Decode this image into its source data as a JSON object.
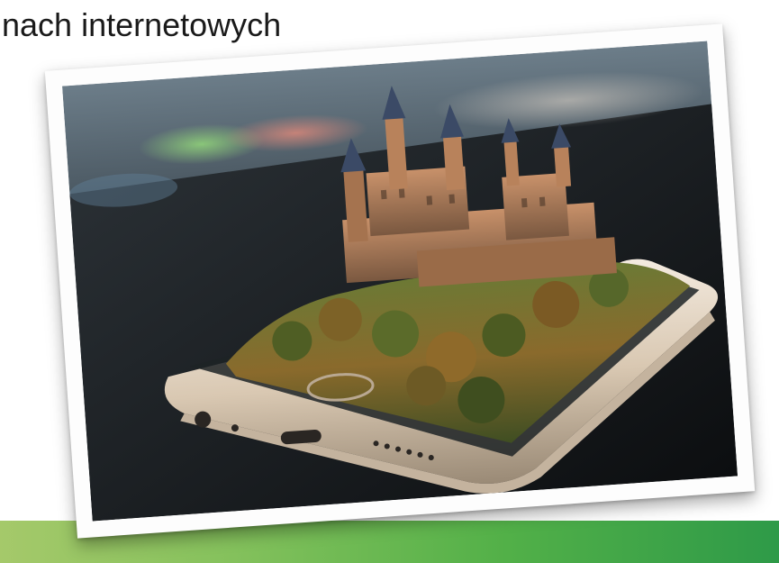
{
  "slide": {
    "title": "nach internetowych"
  },
  "photo": {
    "subject-icon": "phone-with-castle-illustration"
  },
  "colors": {
    "band_left": "#a5c96a",
    "band_right": "#2e9a48",
    "frame": "#fdfdfd"
  }
}
